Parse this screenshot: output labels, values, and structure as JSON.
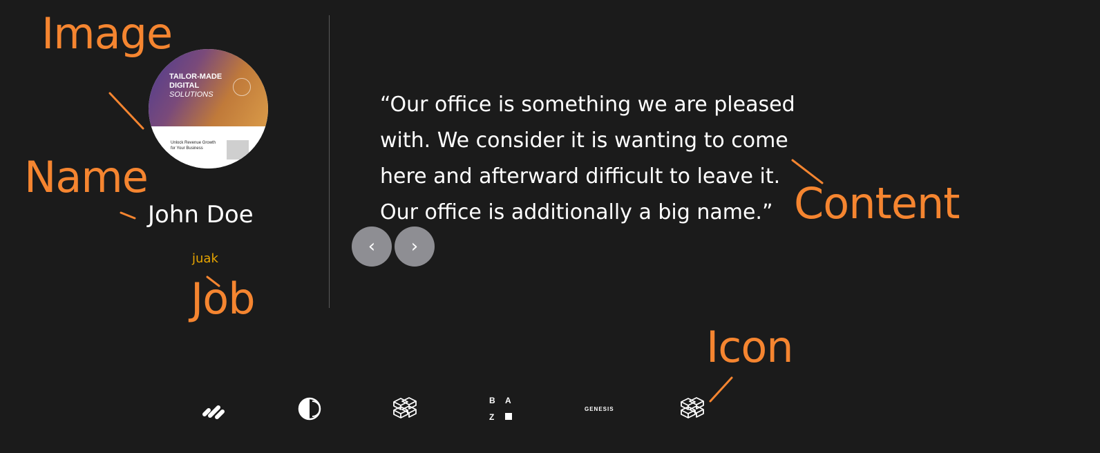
{
  "annotations": {
    "image": "Image",
    "name": "Name",
    "job": "Job",
    "content": "Content",
    "icon": "Icon"
  },
  "testimonial": {
    "image": {
      "hero_line1": "TAILOR-MADE",
      "hero_line2": "DIGITAL",
      "hero_line3": "SOLUTIONS",
      "body_line1": "Unlock Revenue Growth",
      "body_line2": "for Your Business"
    },
    "name": "John Doe",
    "job": "juak",
    "quote_lines": [
      "“Our office is something we are pleased",
      "with. We consider it is wanting to come",
      "here and afterward difficult to leave it.",
      "Our office is additionally a big name.”"
    ]
  },
  "navigation": {
    "prev_label": "‹",
    "next_label": "›"
  },
  "logos": {
    "baz_b": "B",
    "baz_a": "A",
    "baz_z": "Z",
    "genesis": "GENESIS",
    "icons": [
      "slash-mark-logo-icon",
      "half-circle-logo-icon",
      "stacked-blocks-logo-icon",
      "baz-logo-icon",
      "genesis-logo-icon",
      "stacked-blocks-logo-icon"
    ]
  },
  "colors": {
    "background": "#1b1b1b",
    "annotation": "#f58530",
    "job": "#e8a500",
    "nav_button": "#8e8e93",
    "divider": "#5a5a5a"
  }
}
